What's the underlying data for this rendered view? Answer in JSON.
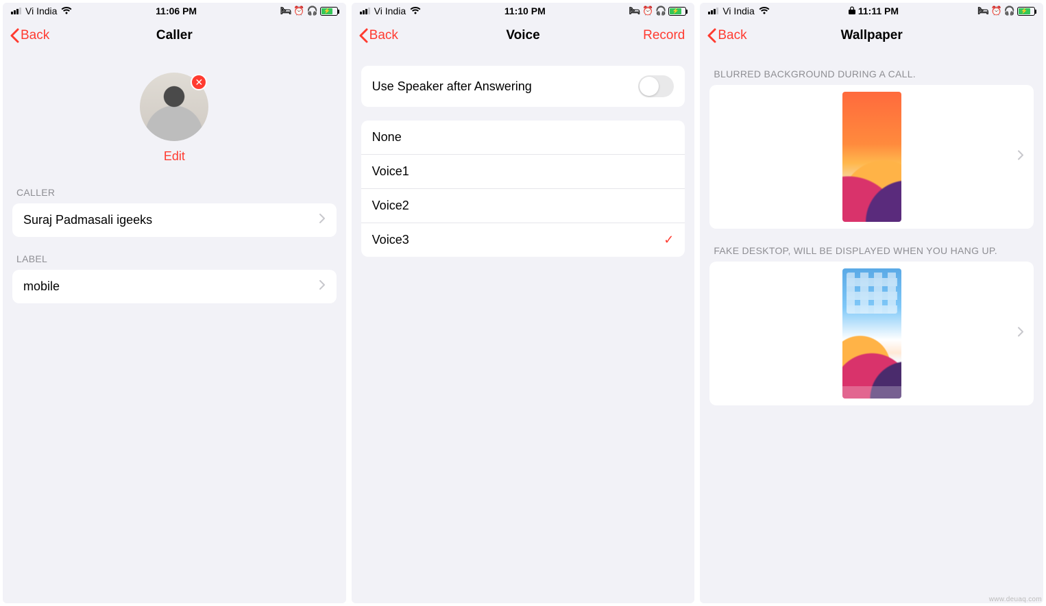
{
  "watermark": "www.deuaq.com",
  "screens": {
    "caller": {
      "status": {
        "carrier": "Vi India",
        "time": "11:06 PM"
      },
      "nav": {
        "back": "Back",
        "title": "Caller"
      },
      "edit": "Edit",
      "sections": {
        "caller_header": "CALLER",
        "caller_name": "Suraj Padmasali igeeks",
        "label_header": "LABEL",
        "label_value": "mobile"
      }
    },
    "voice": {
      "status": {
        "carrier": "Vi India",
        "time": "11:10 PM"
      },
      "nav": {
        "back": "Back",
        "title": "Voice",
        "action": "Record"
      },
      "speaker_label": "Use Speaker after Answering",
      "speaker_on": false,
      "options": [
        {
          "label": "None",
          "selected": false
        },
        {
          "label": "Voice1",
          "selected": false
        },
        {
          "label": "Voice2",
          "selected": false
        },
        {
          "label": "Voice3",
          "selected": true
        }
      ]
    },
    "wallpaper": {
      "status": {
        "carrier": "Vi India",
        "time": "11:11 PM",
        "locked": true
      },
      "nav": {
        "back": "Back",
        "title": "Wallpaper"
      },
      "section1": "BLURRED BACKGROUND DURING A CALL.",
      "section2": "FAKE DESKTOP, WILL BE DISPLAYED WHEN YOU HANG UP."
    }
  }
}
